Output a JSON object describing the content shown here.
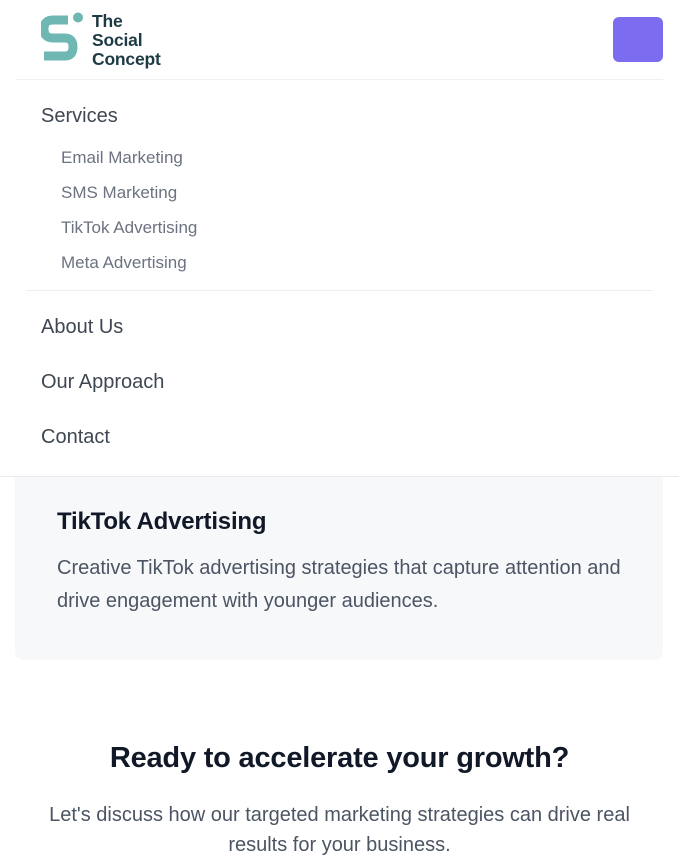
{
  "brand": {
    "name_line1": "The",
    "name_line2": "Social",
    "name_line3": "Concept",
    "color": "#6fb7b3"
  },
  "menu_button": {
    "color": "#7b6cf0"
  },
  "nav": {
    "services_label": "Services",
    "services_items": [
      "Email Marketing",
      "SMS Marketing",
      "TikTok Advertising",
      "Meta Advertising"
    ],
    "about_label": "About Us",
    "approach_label": "Our Approach",
    "contact_label": "Contact"
  },
  "service_card": {
    "title": "TikTok Advertising",
    "description": "Creative TikTok advertising strategies that capture attention and drive engagement with younger audiences."
  },
  "cta": {
    "title": "Ready to accelerate your growth?",
    "description": "Let's discuss how our targeted marketing strategies can drive real results for your business."
  }
}
